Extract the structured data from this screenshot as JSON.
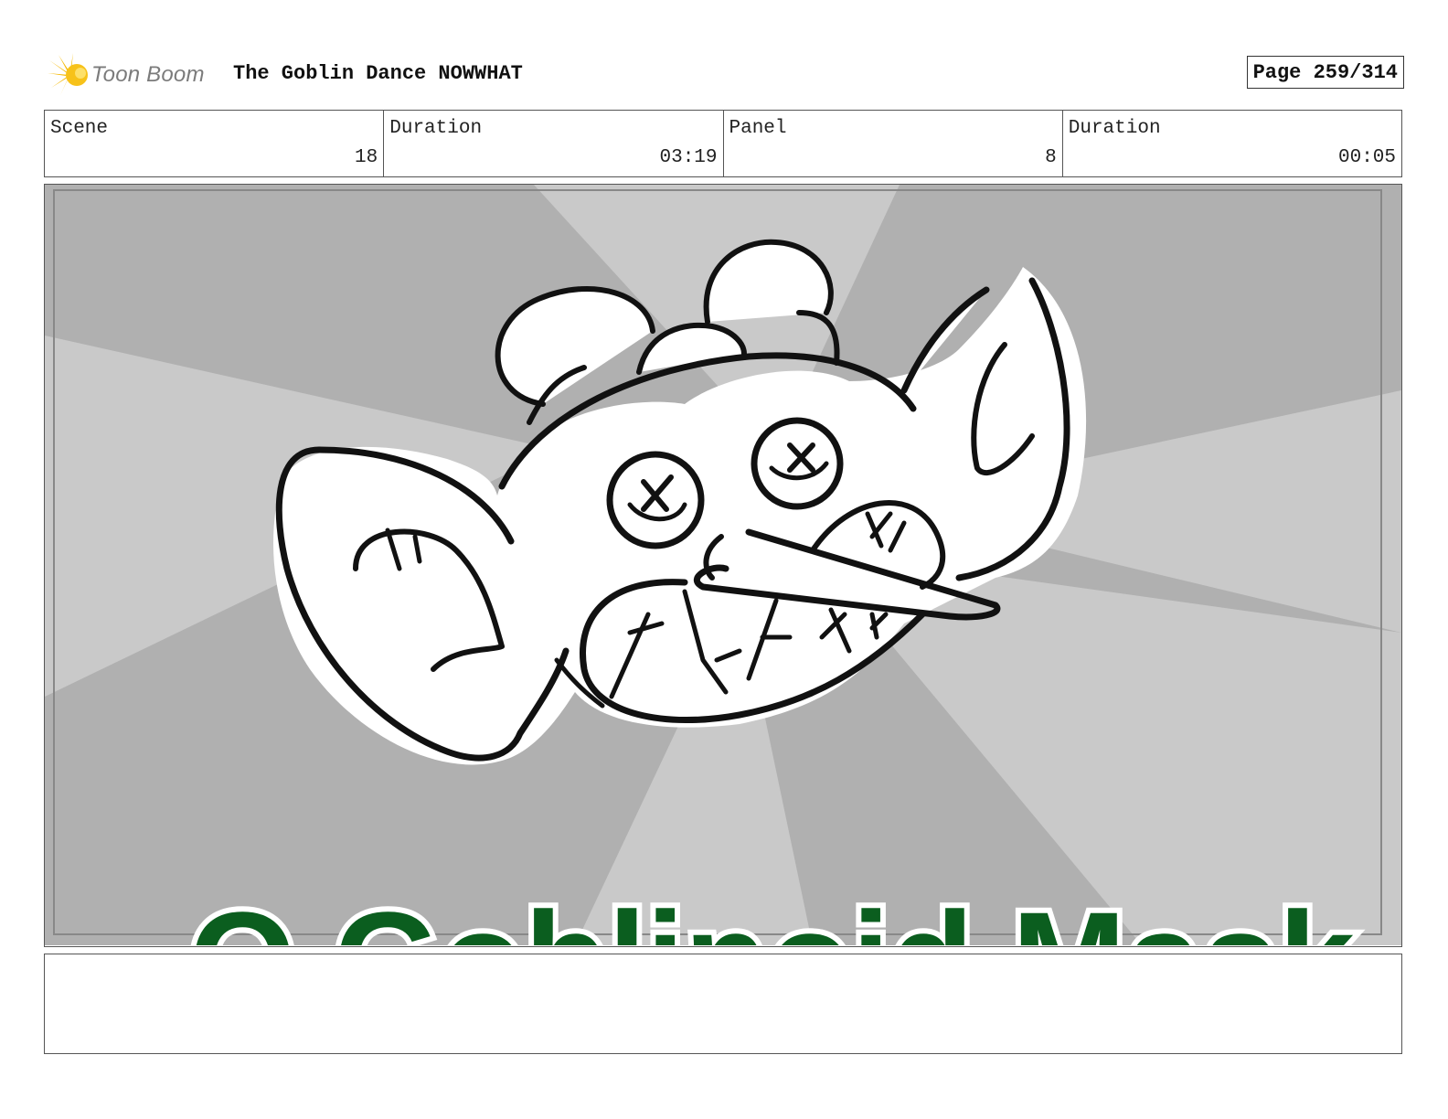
{
  "header": {
    "logo_text": "Toon Boom",
    "project_title": "The Goblin Dance NOWWHAT",
    "page_label": "Page 259/314"
  },
  "info": {
    "scene_label": "Scene",
    "scene_value": "18",
    "scene_duration_label": "Duration",
    "scene_duration_value": "03:19",
    "panel_label": "Panel",
    "panel_value": "8",
    "panel_duration_label": "Duration",
    "panel_duration_value": "00:05"
  },
  "panel": {
    "overlay_text_partial": "O Goblinoid Mask"
  },
  "notes": {
    "text": ""
  },
  "colors": {
    "logo_accent": "#f5b800",
    "ray_light": "#c9c9c9",
    "ray_dark": "#b0b0b0",
    "overlay_green": "#0b5e1f",
    "border": "#555555"
  }
}
